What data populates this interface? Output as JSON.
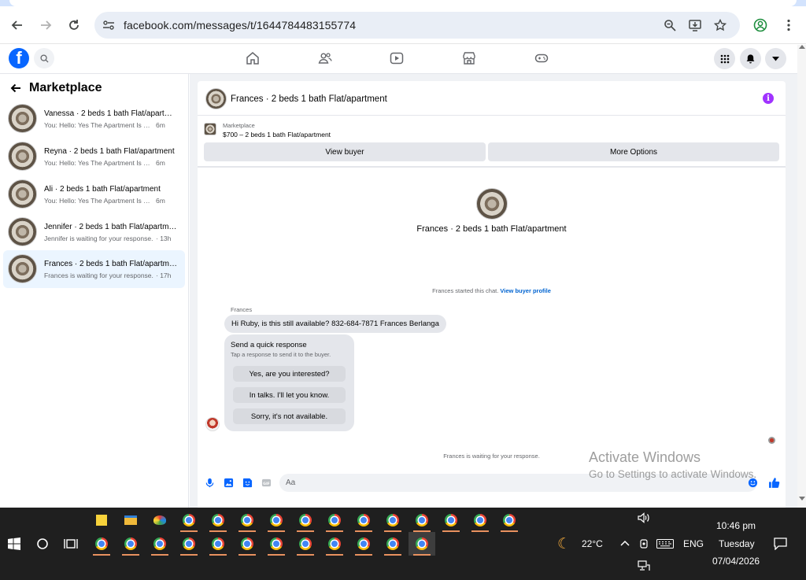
{
  "browser": {
    "url": "facebook.com/messages/t/1644784483155774"
  },
  "leftpanel": {
    "title": "Marketplace",
    "conversations": [
      {
        "name": "Vanessa · 2 beds 1 bath Flat/apartment",
        "preview": "You: Hello: Yes The Apartment Is Still ...",
        "time": "6m"
      },
      {
        "name": "Reyna · 2 beds 1 bath Flat/apartment",
        "preview": "You: Hello: Yes The Apartment Is Still ...",
        "time": "6m"
      },
      {
        "name": "Ali · 2 beds 1 bath Flat/apartment",
        "preview": "You: Hello: Yes The Apartment Is Still ...",
        "time": "6m"
      },
      {
        "name": "Jennifer · 2 beds 1 bath Flat/apartment",
        "preview": "Jennifer is waiting for your response.",
        "time": "· 13h"
      },
      {
        "name": "Frances · 2 beds 1 bath Flat/apartment",
        "preview": "Frances is waiting for your response.",
        "time": "· 17h"
      }
    ]
  },
  "chat": {
    "title": "Frances · 2 beds 1 bath Flat/apartment",
    "listing_label": "Marketplace",
    "listing_price": "$700 – 2 beds 1 bath Flat/apartment",
    "view_buyer": "View buyer",
    "more_options": "More Options",
    "center_name": "Frances · 2 beds 1 bath Flat/apartment",
    "started_text": "Frances started this chat.",
    "view_buyer_profile": "View buyer profile",
    "sender": "Frances",
    "message": "Hi Ruby, is this still available? 832-684-7871 Frances Berlanga",
    "quick_title": "Send a quick response",
    "quick_sub": "Tap a response to send it to the buyer.",
    "quick_options": [
      "Yes, are you interested?",
      "In talks. I'll let you know.",
      "Sorry, it's not available."
    ],
    "waiting": "Frances is waiting for your response.",
    "input_placeholder": "Aa"
  },
  "watermark": {
    "line1": "Activate Windows",
    "line2": "Go to Settings to activate Windows."
  },
  "taskbar": {
    "weather": "22°C",
    "language": "ENG",
    "time": "10:46 pm",
    "day": "Tuesday",
    "date": "07/04/2026"
  }
}
